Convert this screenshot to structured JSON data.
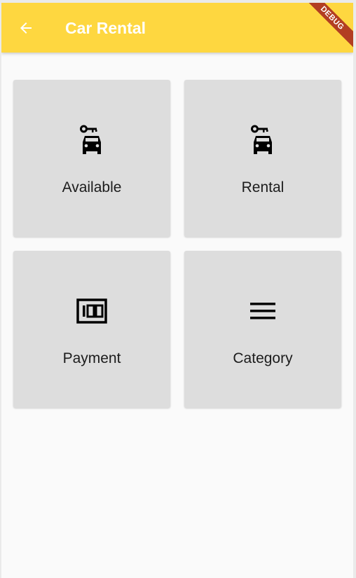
{
  "appbar": {
    "title": "Car Rental",
    "back_icon": "arrow-back-icon",
    "debug_label": "DEBUG",
    "color": "#fed740"
  },
  "cards": [
    {
      "label": "Available",
      "icon": "car-rental-icon"
    },
    {
      "label": "Rental",
      "icon": "car-rental-icon"
    },
    {
      "label": "Payment",
      "icon": "money-100-icon"
    },
    {
      "label": "Category",
      "icon": "menu-lines-icon"
    }
  ]
}
